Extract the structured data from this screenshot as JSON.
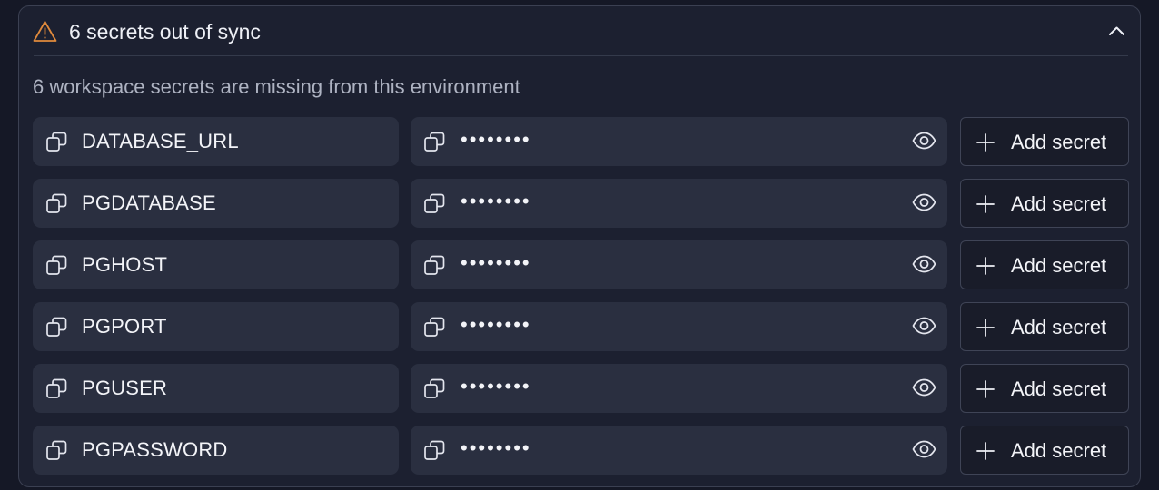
{
  "panel": {
    "title": "6 secrets out of sync",
    "subtitle": "6 workspace secrets are missing from this environment",
    "warning_icon": "warning-triangle-icon",
    "collapse_icon": "chevron-up-icon",
    "warning_color": "#e08a3c"
  },
  "secrets": [
    {
      "key": "DATABASE_URL",
      "value_masked": "••••••••",
      "add_label": "Add secret"
    },
    {
      "key": "PGDATABASE",
      "value_masked": "••••••••",
      "add_label": "Add secret"
    },
    {
      "key": "PGHOST",
      "value_masked": "••••••••",
      "add_label": "Add secret"
    },
    {
      "key": "PGPORT",
      "value_masked": "••••••••",
      "add_label": "Add secret"
    },
    {
      "key": "PGUSER",
      "value_masked": "••••••••",
      "add_label": "Add secret"
    },
    {
      "key": "PGPASSWORD",
      "value_masked": "••••••••",
      "add_label": "Add secret"
    }
  ],
  "icons": {
    "copy": "copy-icon",
    "reveal": "eye-icon",
    "add": "plus-icon"
  }
}
